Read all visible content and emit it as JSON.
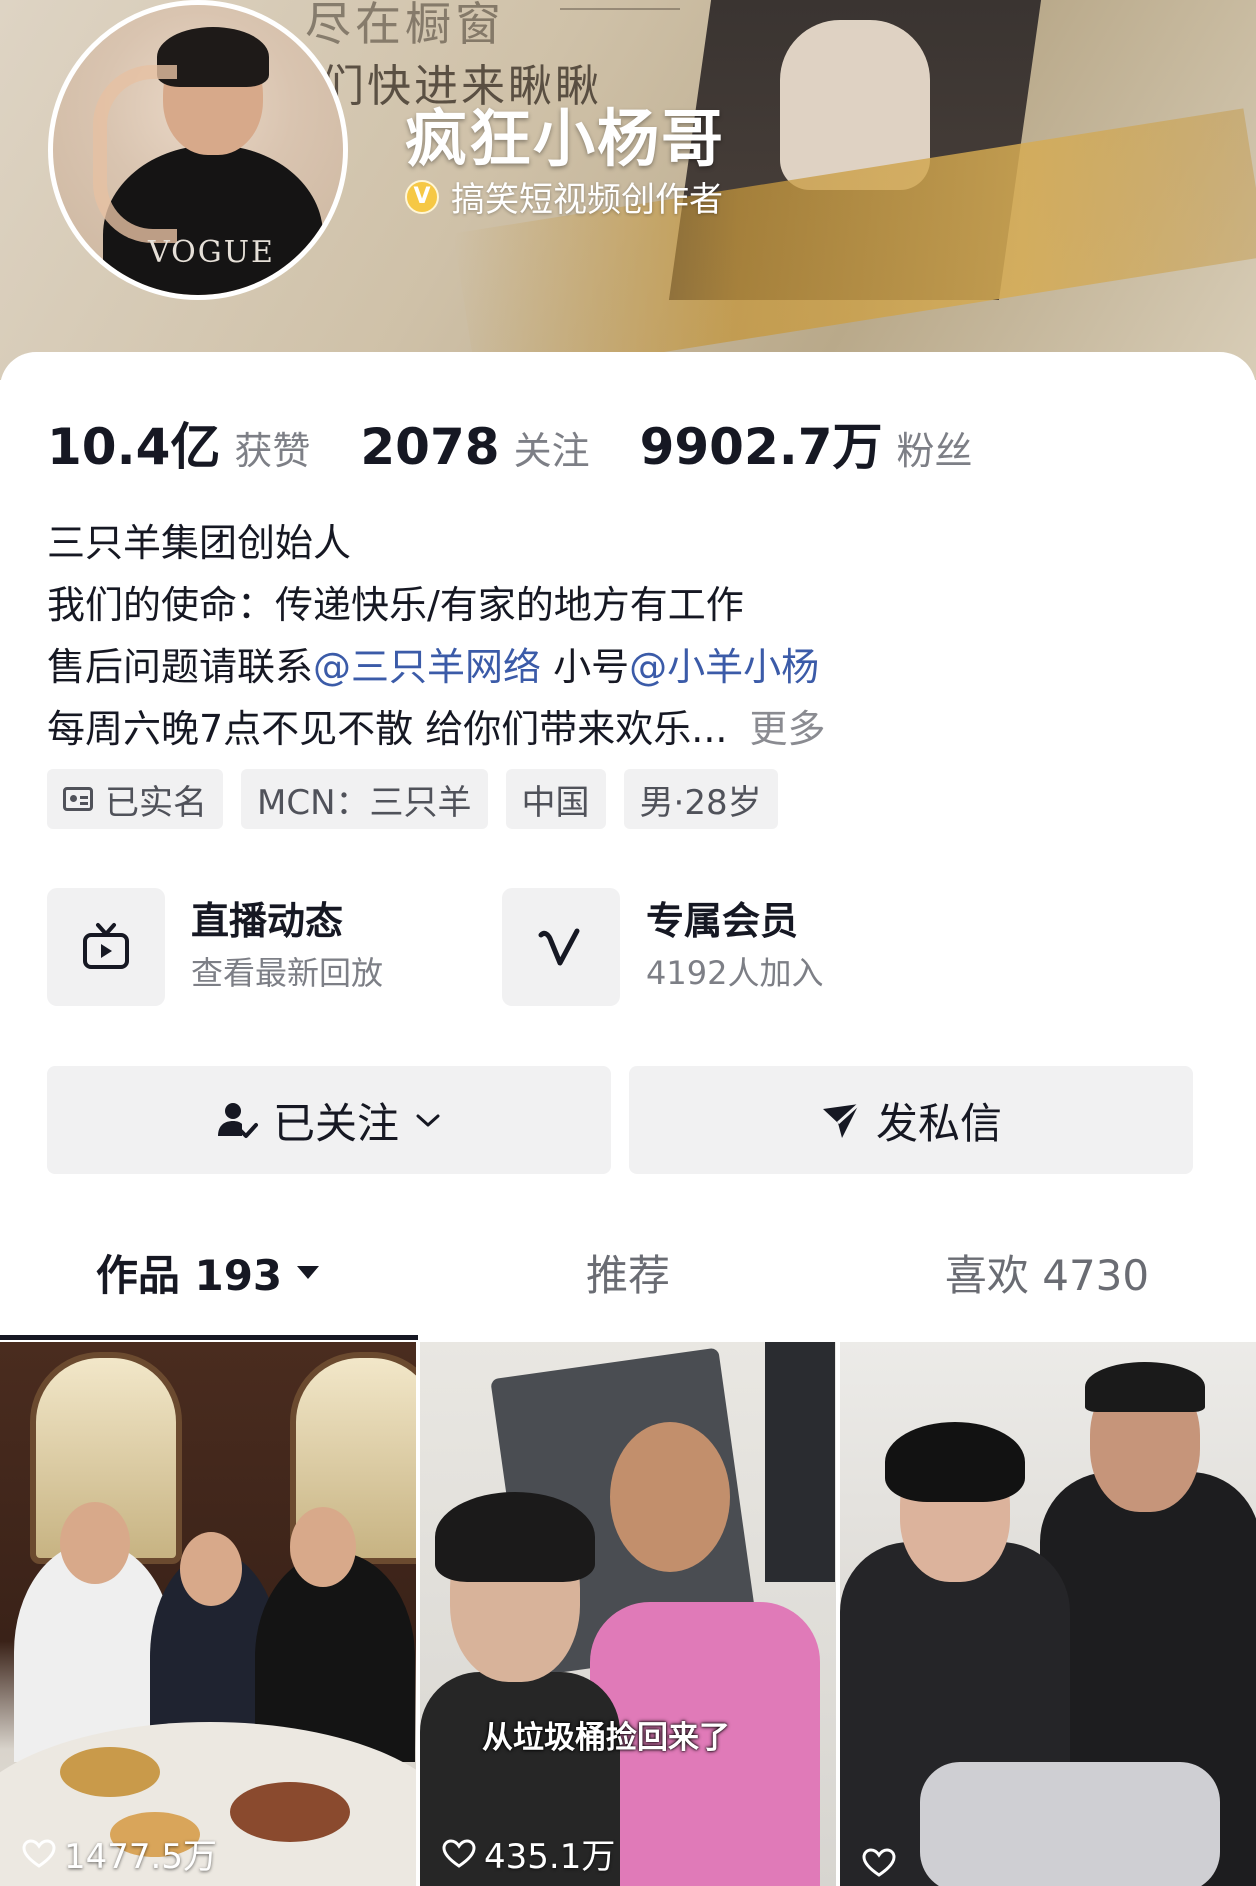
{
  "banner": {
    "text_line1": "尽在橱窗",
    "text_line2": "们快进来瞅瞅"
  },
  "profile": {
    "name": "疯狂小杨哥",
    "verify_mark": "V",
    "verified_label": "搞笑短视频创作者"
  },
  "stats": [
    {
      "value": "10.4亿",
      "label": "获赞"
    },
    {
      "value": "2078",
      "label": "关注"
    },
    {
      "value": "9902.7万",
      "label": "粉丝"
    }
  ],
  "bio": {
    "line1": "三只羊集团创始人",
    "line2": "我们的使命：传递快乐/有家的地方有工作",
    "line3_prefix": "售后问题请联系",
    "line3_mention1": "@三只羊网络",
    "line3_middle": " 小号",
    "line3_mention2": "@小羊小杨",
    "line4": "每周六晚7点不见不散  给你们带来欢乐...",
    "more": "更多"
  },
  "tags": [
    "已实名",
    "MCN：三只羊",
    "中国",
    "男·28岁"
  ],
  "features": [
    {
      "icon": "tv-icon",
      "title": "直播动态",
      "subtitle": "查看最新回放"
    },
    {
      "icon": "v-icon",
      "title": "专属会员",
      "subtitle": "4192人加入"
    }
  ],
  "buttons": {
    "follow_label": "已关注",
    "message_label": "发私信"
  },
  "tabs": [
    {
      "label": "作品 193",
      "active": true
    },
    {
      "label": "推荐",
      "active": false
    },
    {
      "label": "喜欢 4730",
      "active": false
    }
  ],
  "videos": [
    {
      "likes": "1477.5万",
      "caption": ""
    },
    {
      "likes": "435.1万",
      "caption": "从垃圾桶捡回来了"
    },
    {
      "likes": "",
      "caption": ""
    }
  ],
  "colors": {
    "mention": "#3b5ba8",
    "verify_badge": "#f6c845",
    "chip_bg": "#f1f1f2"
  }
}
